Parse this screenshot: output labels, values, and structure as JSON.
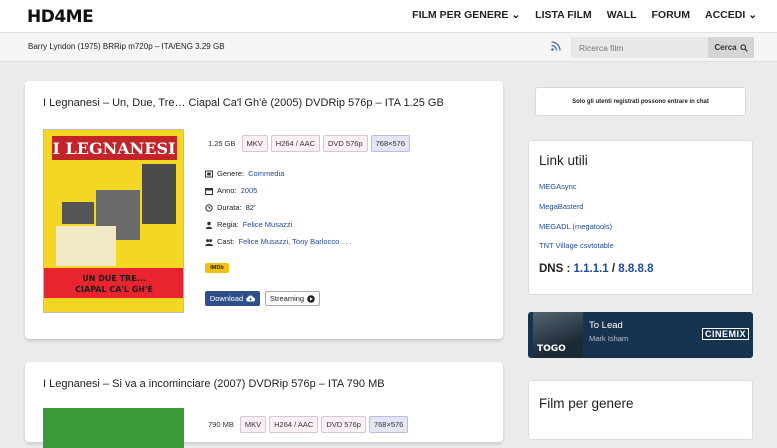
{
  "header": {
    "logo": "HD4ME",
    "nav": [
      {
        "label": "FILM PER GENERE",
        "has_caret": true
      },
      {
        "label": "LISTA FILM",
        "has_caret": false
      },
      {
        "label": "WALL",
        "has_caret": false
      },
      {
        "label": "FORUM",
        "has_caret": false
      },
      {
        "label": "ACCEDI",
        "has_caret": true
      }
    ]
  },
  "subbar": {
    "now_playing": "Barry Lyndon (1975) BRRip m720p – ITA/ENG 3.29 GB",
    "search_placeholder": "Ricerca film",
    "search_button": "Cerca"
  },
  "posts": [
    {
      "title": "I Legnanesi – Un, Due, Tre… Ciapal Ca'l Gh'è (2005) DVDRip 576p – ITA 1.25 GB",
      "size": "1.25 GB",
      "tags": [
        "MKV",
        "H264 / AAC",
        "DVD 576p",
        "768×576"
      ],
      "genre_label": "Genere:",
      "genre": "Commedia",
      "year_label": "Anno:",
      "year": "2005",
      "duration_label": "Durata:",
      "duration": "82'",
      "director_label": "Regia:",
      "director": "Felice Musazzi",
      "cast_label": "Cast:",
      "cast": "Felice Musazzi, Tony Barlocco . . .",
      "imdb": "IMDb",
      "download_label": "Download",
      "streaming_label": "Streaming",
      "poster_title": "I LEGNANESI",
      "poster_caption": "UN DUE TRE... CIAPAL CA'L GH'È"
    },
    {
      "title": "I Legnanesi – Si va a incominciare (2007) DVDRip 576p – ITA 790 MB",
      "size": "790 MB",
      "tags": [
        "MKV",
        "H264 / AAC",
        "DVD 576p",
        "768×576"
      ]
    }
  ],
  "sidebar": {
    "chat_notice": "Solo gli utenti registrati possono entrare in chat",
    "links_title": "Link utili",
    "links": [
      "MEGAsync",
      "MegaBasterd",
      "MEGADL (megatools)",
      "TNT Village csvtotable"
    ],
    "dns_label": "DNS :",
    "dns_primary": "1.1.1.1",
    "dns_separator": "/",
    "dns_secondary": "8.8.8.8",
    "player": {
      "track": "To Lead",
      "artist": "Mark Isham",
      "cover_text": "TOGO",
      "brand": "CINEMIX"
    },
    "genre_title": "Film per genere"
  },
  "colors": {
    "link": "#1f4b9b",
    "download_button": "#2f4f8a",
    "poster_yellow": "#f4d722",
    "imdb_yellow": "#f2c012",
    "player_bg": "#16334f"
  }
}
